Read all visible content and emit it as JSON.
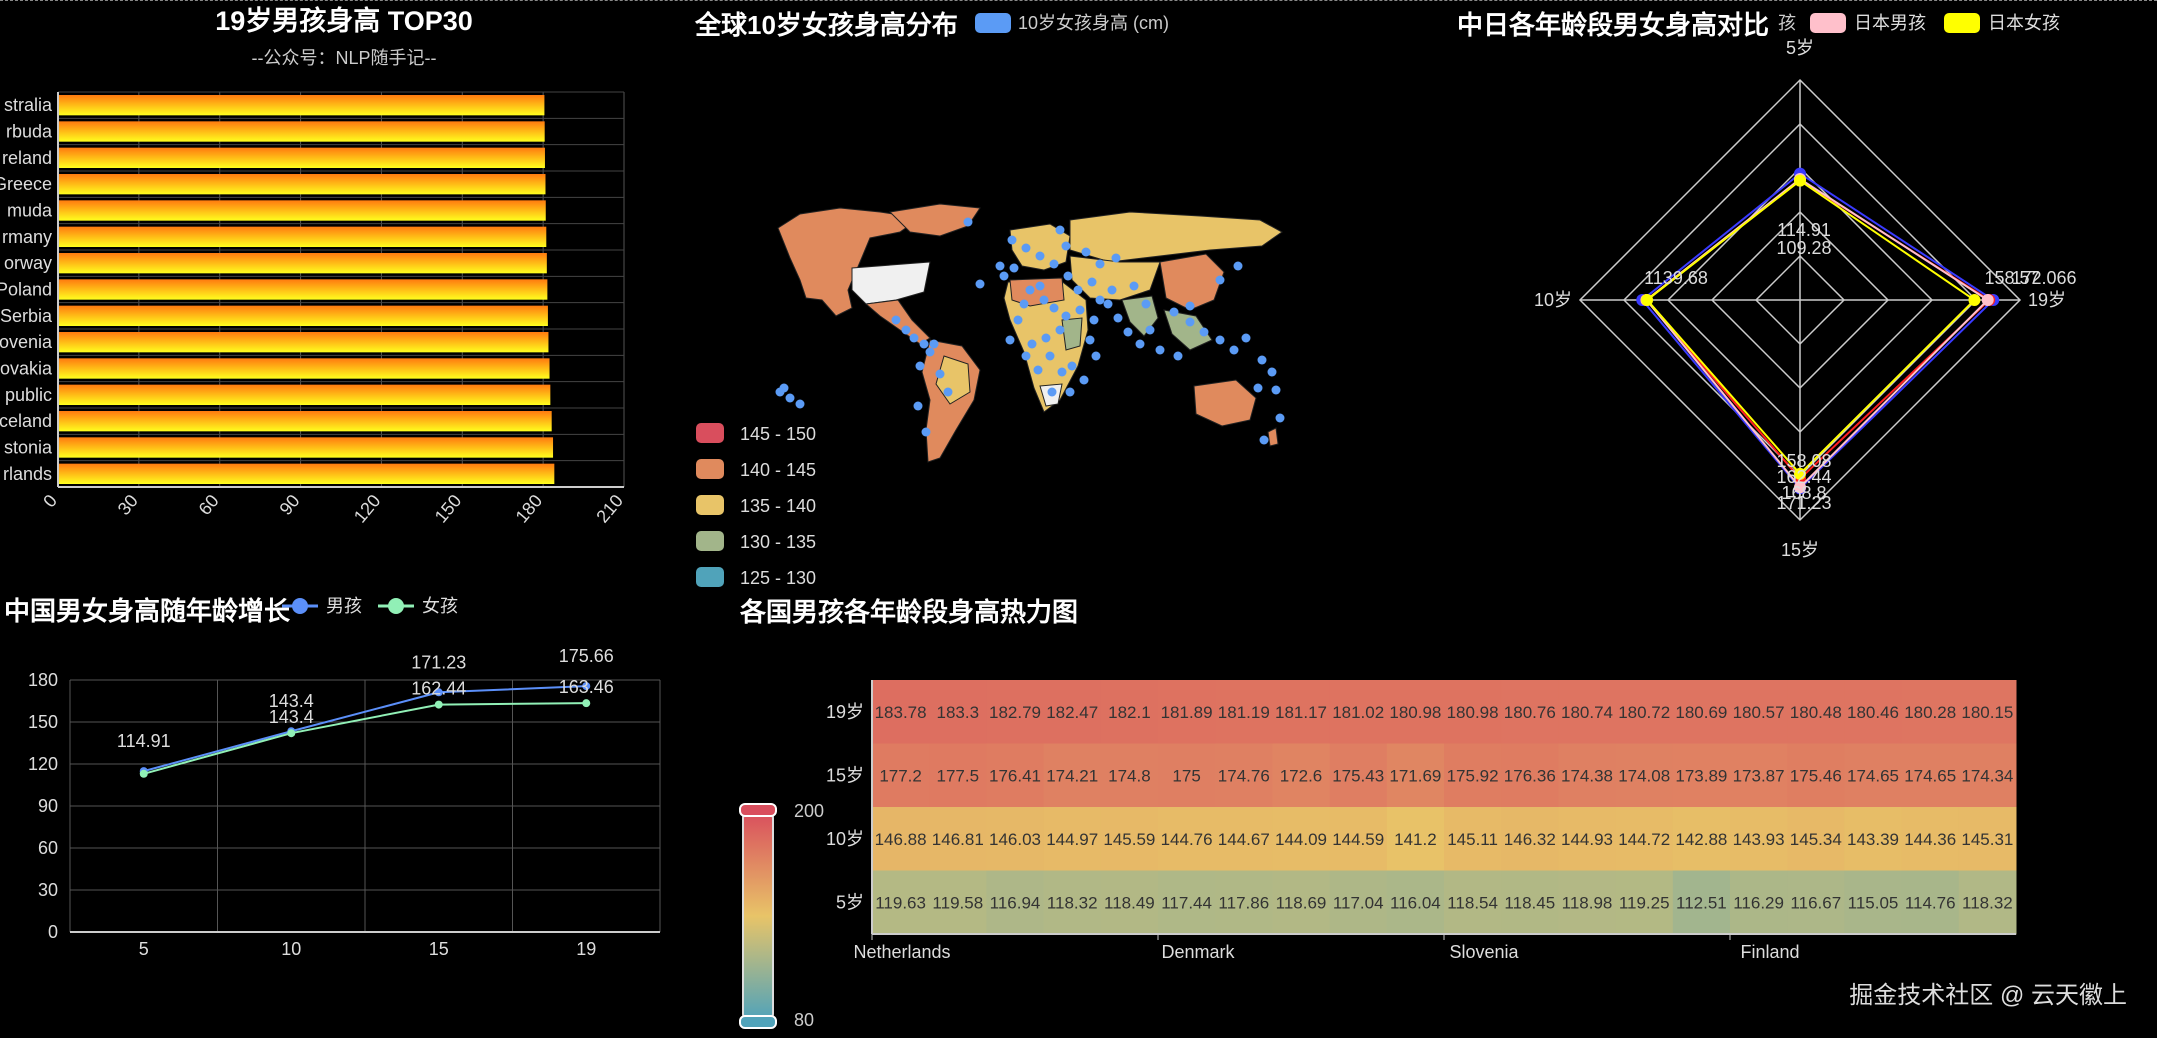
{
  "chart_data": [
    {
      "id": "bar",
      "type": "bar",
      "orientation": "horizontal",
      "title": "19岁男孩身高 TOP30",
      "subtitle": "--公众号：NLP随手记--",
      "y_tick_labels": [
        "stralia",
        "rbuda",
        "reland",
        "Greece",
        "muda",
        "rmany",
        "orway",
        "Poland",
        "Serbia",
        "ovenia",
        "ovakia",
        "public",
        "celand",
        "stonia",
        "rlands"
      ],
      "values": [
        180.1,
        180.2,
        180.3,
        180.5,
        180.6,
        180.8,
        181.0,
        181.2,
        181.4,
        181.6,
        182.0,
        182.3,
        182.8,
        183.3,
        183.78
      ],
      "xticks": [
        0,
        30,
        60,
        90,
        120,
        150,
        180,
        210
      ],
      "xlim": [
        0,
        210
      ],
      "colors": [
        "#ff7a0f",
        "#ffff1e"
      ]
    },
    {
      "id": "map",
      "type": "map",
      "title": "全球10岁女孩身高分布",
      "legend": "10岁女孩身高 (cm)",
      "legend_color": "#5b9bf5",
      "visual_map": [
        {
          "label": "145 - 150",
          "color": "#d94e5d"
        },
        {
          "label": "140 - 145",
          "color": "#e08a5d"
        },
        {
          "label": "135 - 140",
          "color": "#e8c468"
        },
        {
          "label": "130 - 135",
          "color": "#a2b58a"
        },
        {
          "label": "125 - 130",
          "color": "#50a3ba"
        }
      ]
    },
    {
      "id": "radar",
      "type": "radar",
      "title": "中日各年龄段男女身高对比",
      "legend_fragments": [
        "孩",
        "女孩"
      ],
      "legend": [
        {
          "name": "日本男孩",
          "color": "#ffc0cb"
        },
        {
          "name": "日本女孩",
          "color": "#ffff00"
        }
      ],
      "axes": [
        "5岁",
        "19岁",
        "15岁",
        "10岁"
      ],
      "max": 200,
      "series": [
        {
          "color": "#3a3aff",
          "values": [
            114.91,
            175.66,
            171.23,
            143.4
          ]
        },
        {
          "color": "#ff1f1f",
          "values": [
            109.28,
            172.0,
            162.44,
            139.68
          ]
        },
        {
          "color": "#ffc0cb",
          "values": [
            110.0,
            170.66,
            170.23,
            139.6
          ]
        },
        {
          "color": "#ffff00",
          "values": [
            108.5,
            158.57,
            158.08,
            139.0
          ]
        }
      ],
      "value_labels": [
        "114.91",
        "109.28",
        "158.57",
        "172.066",
        "1139.68",
        "158.08",
        "162.44",
        "168.8",
        "171.23"
      ]
    },
    {
      "id": "line",
      "type": "line",
      "title": "中国男女身高随年龄增长",
      "categories": [
        "5",
        "10",
        "15",
        "19"
      ],
      "series": [
        {
          "name": "男孩",
          "color": "#5b8ff9",
          "values": [
            114.91,
            143.4,
            171.23,
            175.66
          ],
          "labels": [
            "114.91",
            "143.4",
            "171.23",
            "175.66"
          ]
        },
        {
          "name": "女孩",
          "color": "#91f0b6",
          "values": [
            113.0,
            142.0,
            162.44,
            163.46
          ],
          "labels": [
            "",
            "143.4",
            "162.44",
            "163.46"
          ]
        }
      ],
      "ylim": [
        0,
        180
      ],
      "yticks": [
        0,
        30,
        60,
        90,
        120,
        150,
        180
      ]
    },
    {
      "id": "heatmap",
      "type": "heatmap",
      "title": "各国男孩各年龄段身高热力图",
      "y_categories": [
        "19岁",
        "15岁",
        "10岁",
        "5岁"
      ],
      "x_tick_labels": [
        "Netherlands",
        "Denmark",
        "Slovenia",
        "Finland"
      ],
      "rows": [
        [
          183.78,
          183.3,
          182.79,
          182.47,
          182.1,
          181.89,
          181.19,
          181.17,
          181.02,
          180.98,
          180.98,
          180.76,
          180.74,
          180.72,
          180.69,
          180.57,
          180.48,
          180.46,
          180.28,
          180.15
        ],
        [
          177.2,
          177.5,
          176.41,
          174.21,
          174.8,
          175,
          174.76,
          172.6,
          175.43,
          171.69,
          175.92,
          176.36,
          174.38,
          174.08,
          173.89,
          173.87,
          175.46,
          174.65,
          174.65,
          174.34
        ],
        [
          146.88,
          146.81,
          146.03,
          144.97,
          145.59,
          144.76,
          144.67,
          144.09,
          144.59,
          141.2,
          145.11,
          146.32,
          144.93,
          144.72,
          142.88,
          143.93,
          145.34,
          143.39,
          144.36,
          145.31
        ],
        [
          119.63,
          119.58,
          116.94,
          118.32,
          118.49,
          117.44,
          117.86,
          118.69,
          117.04,
          116.04,
          118.54,
          118.45,
          118.98,
          119.25,
          112.51,
          116.29,
          116.67,
          115.05,
          114.76,
          118.32
        ]
      ],
      "visual_map": {
        "max": "200",
        "min": "80"
      }
    }
  ],
  "watermark": "掘金技术社区 @ 云天徽上"
}
